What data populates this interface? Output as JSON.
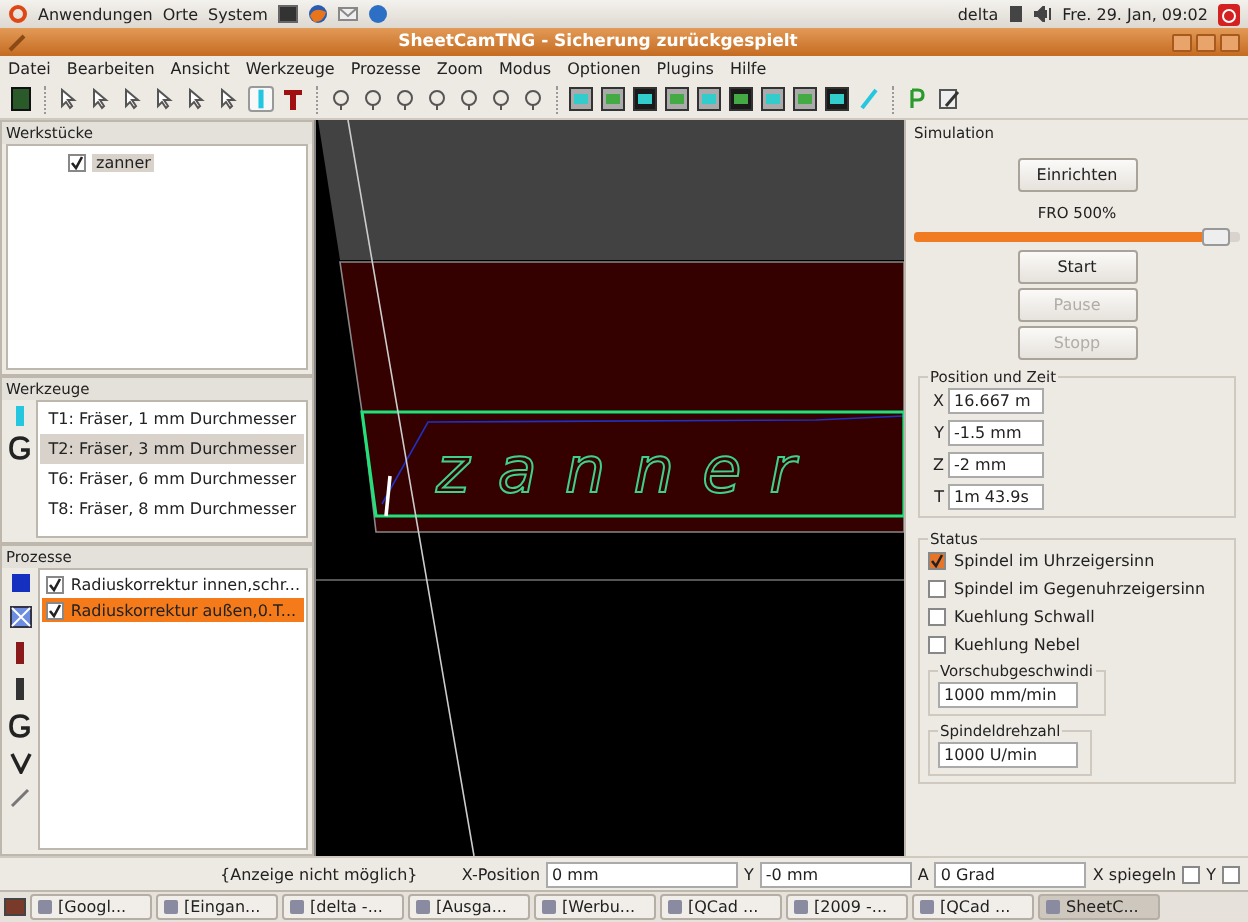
{
  "top_panel": {
    "menus": [
      "Anwendungen",
      "Orte",
      "System"
    ],
    "user": "delta",
    "clock": "Fre. 29. Jan, 09:02"
  },
  "window": {
    "title": "SheetCamTNG - Sicherung zurückgespielt"
  },
  "menu": [
    "Datei",
    "Bearbeiten",
    "Ansicht",
    "Werkzeuge",
    "Prozesse",
    "Zoom",
    "Modus",
    "Optionen",
    "Plugins",
    "Hilfe"
  ],
  "workpieces": {
    "title": "Werkstücke",
    "items": [
      {
        "label": "zanner",
        "checked": true,
        "selected": true
      }
    ]
  },
  "tools": {
    "title": "Werkzeuge",
    "items": [
      {
        "label": "T1: Fräser, 1 mm Durchmesser",
        "selected": false
      },
      {
        "label": "T2: Fräser, 3 mm Durchmesser",
        "selected": true
      },
      {
        "label": "T6: Fräser, 6 mm Durchmesser",
        "selected": false
      },
      {
        "label": "T8: Fräser, 8 mm Durchmesser",
        "selected": false
      }
    ]
  },
  "processes": {
    "title": "Prozesse",
    "items": [
      {
        "label": "Radiuskorrektur innen,schr...",
        "checked": true,
        "selected": false
      },
      {
        "label": "Radiuskorrektur außen,0.T...",
        "checked": true,
        "selected": true
      }
    ]
  },
  "canvas": {
    "label": "zanner"
  },
  "simulation": {
    "title": "Simulation",
    "setup_button": "Einrichten",
    "fro_label": "FRO 500%",
    "fro": {
      "level": 0.97
    },
    "buttons": [
      {
        "label": "Start",
        "disabled": false
      },
      {
        "label": "Pause",
        "disabled": true
      },
      {
        "label": "Stopp",
        "disabled": true
      }
    ]
  },
  "position": {
    "title": "Position und Zeit",
    "fields": [
      {
        "axis": "X",
        "value": "16.667 m"
      },
      {
        "axis": "Y",
        "value": "-1.5 mm"
      },
      {
        "axis": "Z",
        "value": "-2 mm"
      },
      {
        "axis": "T",
        "value": "1m 43.9s"
      }
    ]
  },
  "status": {
    "title": "Status",
    "checks": [
      {
        "label": "Spindel im Uhrzeigersinn",
        "checked": true
      },
      {
        "label": "Spindel im Gegenuhrzeigersinn",
        "checked": false
      },
      {
        "label": "Kuehlung Schwall",
        "checked": false
      },
      {
        "label": "Kuehlung Nebel",
        "checked": false
      }
    ],
    "feed": {
      "label": "Vorschubgeschwindi",
      "value": "1000 mm/min"
    },
    "spindle": {
      "label": "Spindeldrehzahl",
      "value": "1000 U/min"
    }
  },
  "status_bar": {
    "message": "{Anzeige nicht möglich}",
    "x_label": "X-Position",
    "x_value": "0 mm",
    "y_label": "Y",
    "y_value": "-0 mm",
    "a_label": "A",
    "a_value": "0 Grad",
    "mirror_x": {
      "label": "X spiegeln",
      "checked": false
    },
    "mirror_y": {
      "label": "Y",
      "checked": false
    }
  },
  "taskbar": [
    {
      "label": "[Googl...",
      "selected": false
    },
    {
      "label": "[Eingan...",
      "selected": false
    },
    {
      "label": "[delta -...",
      "selected": false
    },
    {
      "label": "[Ausga...",
      "selected": false
    },
    {
      "label": "[Werbu...",
      "selected": false
    },
    {
      "label": "[QCad ...",
      "selected": false
    },
    {
      "label": "[2009 -...",
      "selected": false
    },
    {
      "label": "[QCad ...",
      "selected": false
    },
    {
      "label": "SheetC...",
      "selected": true
    }
  ]
}
